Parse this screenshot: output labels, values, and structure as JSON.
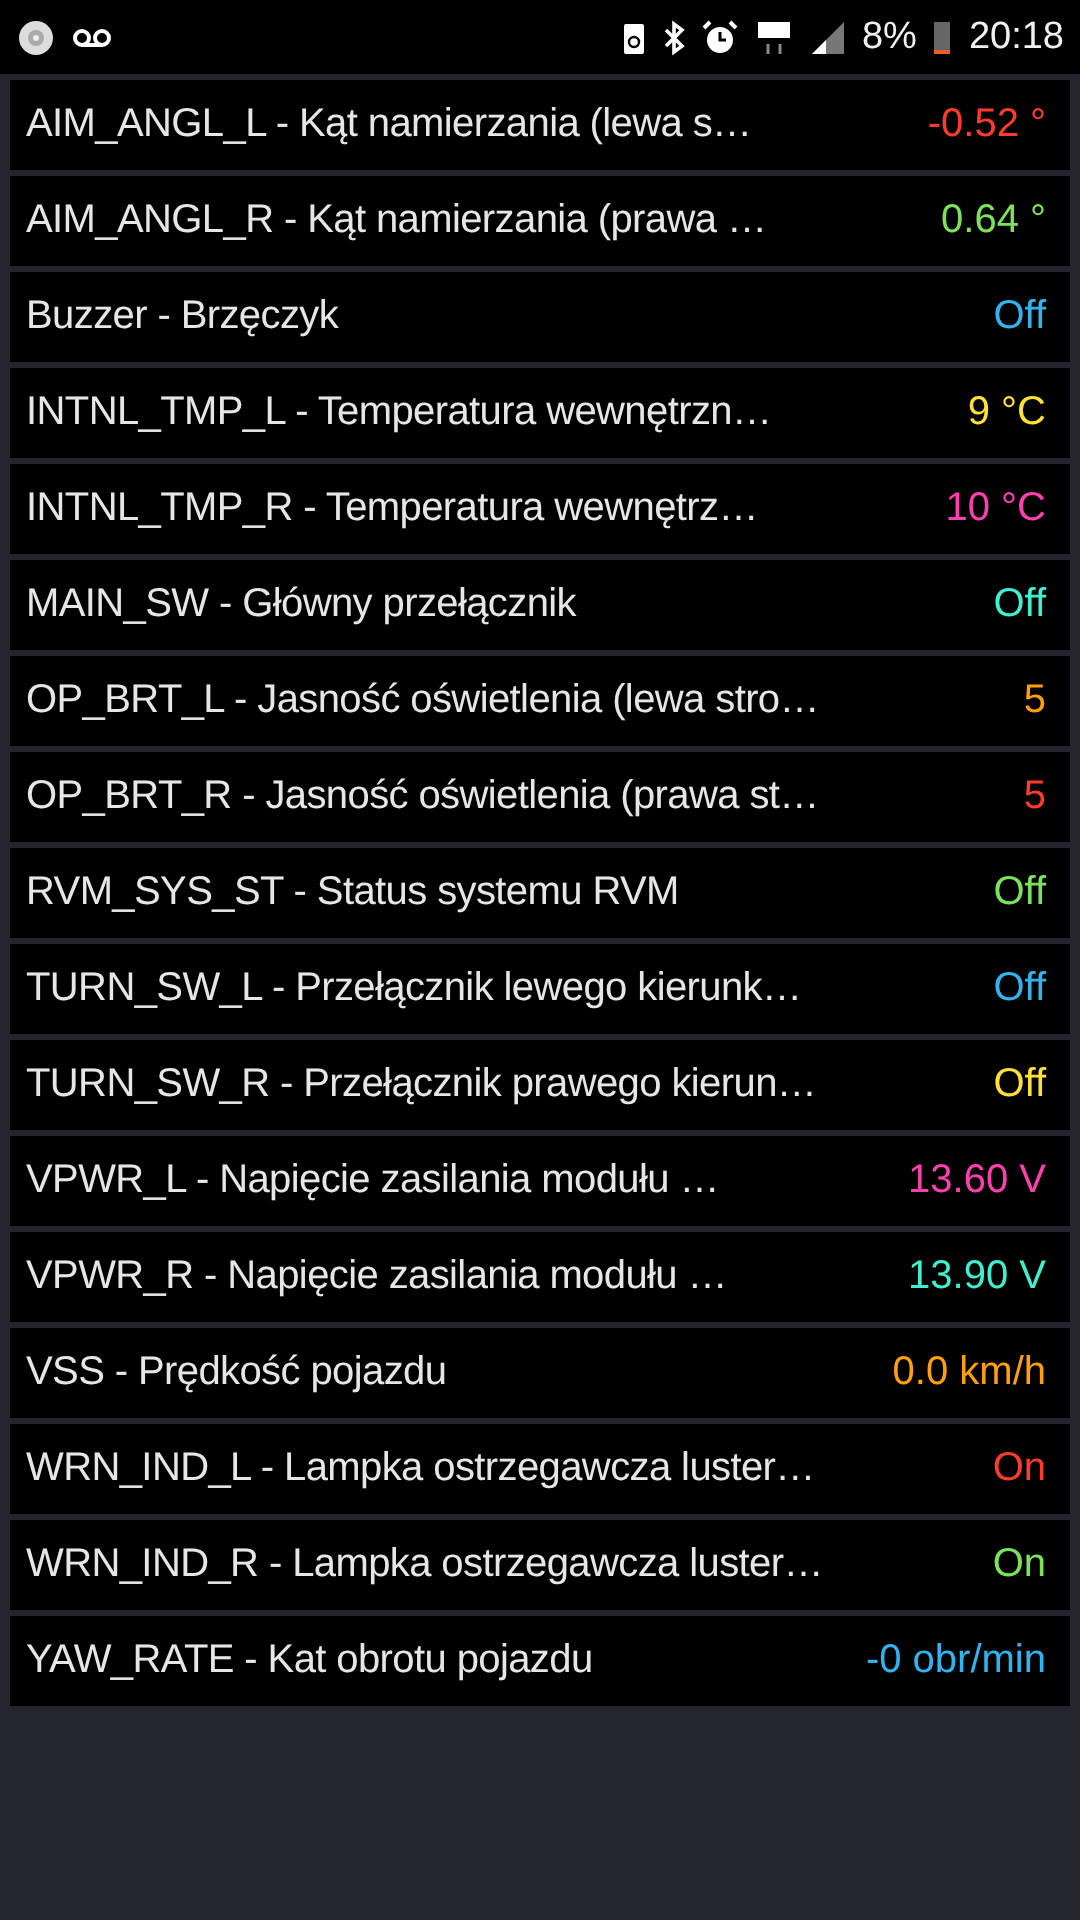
{
  "status_bar": {
    "battery": "8%",
    "time": "20:18"
  },
  "rows": [
    {
      "label": "AIM_ANGL_L - Kąt namierzania (lewa s…",
      "value": "-0.52 °",
      "color": "#ff3b30"
    },
    {
      "label": "AIM_ANGL_R - Kąt namierzania (prawa …",
      "value": "0.64 °",
      "color": "#7be35a"
    },
    {
      "label": "Buzzer - Brzęczyk",
      "value": "Off",
      "color": "#2fb4f0"
    },
    {
      "label": "INTNL_TMP_L - Temperatura wewnętrzn…",
      "value": "9 °C",
      "color": "#ffe135"
    },
    {
      "label": "INTNL_TMP_R - Temperatura wewnętrz…",
      "value": "10 °C",
      "color": "#ff3fb0"
    },
    {
      "label": "MAIN_SW - Główny przełącznik",
      "value": "Off",
      "color": "#3ff0d0"
    },
    {
      "label": "OP_BRT_L - Jasność oświetlenia (lewa stro…",
      "value": "5",
      "color": "#ff9f0a"
    },
    {
      "label": "OP_BRT_R - Jasność oświetlenia (prawa st…",
      "value": "5",
      "color": "#ff3b30"
    },
    {
      "label": "RVM_SYS_ST - Status systemu RVM",
      "value": "Off",
      "color": "#7be35a"
    },
    {
      "label": "TURN_SW_L - Przełącznik lewego kierunk…",
      "value": "Off",
      "color": "#2fb4f0"
    },
    {
      "label": "TURN_SW_R - Przełącznik prawego kierun…",
      "value": "Off",
      "color": "#ffe135"
    },
    {
      "label": "VPWR_L - Napięcie zasilania modułu …",
      "value": "13.60 V",
      "color": "#ff3fb0"
    },
    {
      "label": "VPWR_R - Napięcie zasilania modułu …",
      "value": "13.90 V",
      "color": "#3ff0d0"
    },
    {
      "label": "VSS - Prędkość pojazdu",
      "value": "0.0 km/h",
      "color": "#ff9f0a"
    },
    {
      "label": "WRN_IND_L - Lampka ostrzegawcza luster…",
      "value": "On",
      "color": "#ff3b30"
    },
    {
      "label": "WRN_IND_R - Lampka ostrzegawcza luster…",
      "value": "On",
      "color": "#7be35a"
    },
    {
      "label": "YAW_RATE - Kat obrotu pojazdu",
      "value": "-0 obr/min",
      "color": "#2fb4f0"
    }
  ]
}
